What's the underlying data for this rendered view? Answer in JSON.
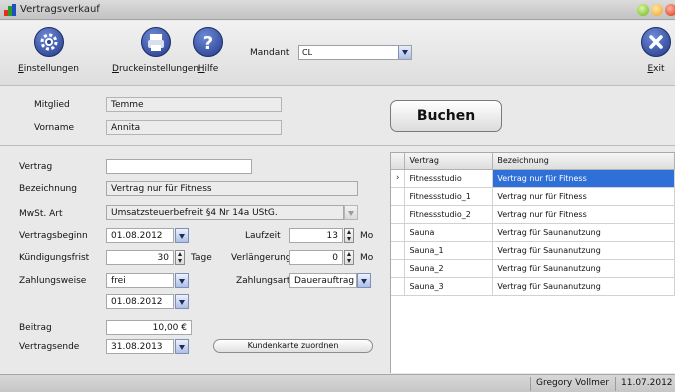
{
  "window": {
    "title": "Vertragsverkauf"
  },
  "toolbar": {
    "buttons": [
      {
        "label_key": "E",
        "label_rest": "instellungen",
        "icon": "gear-icon"
      },
      {
        "label_key": "D",
        "label_rest": "ruckeinstellungen",
        "icon": "printer-icon"
      },
      {
        "label_key": "H",
        "label_rest": "ilfe",
        "icon": "help-icon"
      }
    ],
    "mandant_label": "Mandant",
    "mandant_value": "CL",
    "exit_key": "E",
    "exit_rest": "xit"
  },
  "member": {
    "mitglied_label": "Mitglied",
    "mitglied_value": "Temme",
    "vorname_label": "Vorname",
    "vorname_value": "Annita",
    "buchen_label": "Buchen"
  },
  "form": {
    "vertrag_label": "Vertrag",
    "vertrag_value": "",
    "bezeichnung_label": "Bezeichnung",
    "bezeichnung_value": "Vertrag nur für Fitness",
    "mwst_label": "MwSt. Art",
    "mwst_value": "Umsatzsteuerbefreit §4 Nr 14a UStG.",
    "vertragsbeginn_label": "Vertragsbeginn",
    "vertragsbeginn_value": "01.08.2012",
    "laufzeit_label": "Laufzeit",
    "laufzeit_value": "13",
    "laufzeit_unit": "Mo",
    "kuendigungsfrist_label": "Kündigungsfrist",
    "kuendigungsfrist_value": "30",
    "kuendigungsfrist_unit": "Tage",
    "verlaengerung_label": "Verlängerung",
    "verlaengerung_value": "0",
    "verlaengerung_unit": "Mo",
    "zahlungsweise_label": "Zahlungsweise",
    "zahlungsweise_value": "frei",
    "zahlungsart_label": "Zahlungsart",
    "zahlungsart_value": "Dauerauftrag",
    "zahlungsdatum_value": "01.08.2012",
    "beitrag_label": "Beitrag",
    "beitrag_value": "10,00 €",
    "vertragsende_label": "Vertragsende",
    "vertragsende_value": "31.08.2013",
    "kundenkarte_label": "Kundenkarte zuordnen"
  },
  "grid": {
    "columns": [
      "Vertrag",
      "Bezeichnung"
    ],
    "rows": [
      {
        "marker": "›",
        "vertrag": "Fitnessstudio",
        "bezeichnung": "Vertrag nur für Fitness"
      },
      {
        "marker": "",
        "vertrag": "Fitnessstudio_1",
        "bezeichnung": "Vertrag nur für Fitness"
      },
      {
        "marker": "",
        "vertrag": "Fitnessstudio_2",
        "bezeichnung": "Vertrag nur für Fitness"
      },
      {
        "marker": "",
        "vertrag": "Sauna",
        "bezeichnung": "Vertrag für Saunanutzung"
      },
      {
        "marker": "",
        "vertrag": "Sauna_1",
        "bezeichnung": "Vertrag für Saunanutzung"
      },
      {
        "marker": "",
        "vertrag": "Sauna_2",
        "bezeichnung": "Vertrag für Saunanutzung"
      },
      {
        "marker": "",
        "vertrag": "Sauna_3",
        "bezeichnung": "Vertrag für Saunanutzung"
      }
    ]
  },
  "status": {
    "user": "Gregory Vollmer",
    "date": "11.07.2012"
  },
  "colors": {
    "selection": "#2f6fd8",
    "toolbar_icon": "#233a8a"
  }
}
